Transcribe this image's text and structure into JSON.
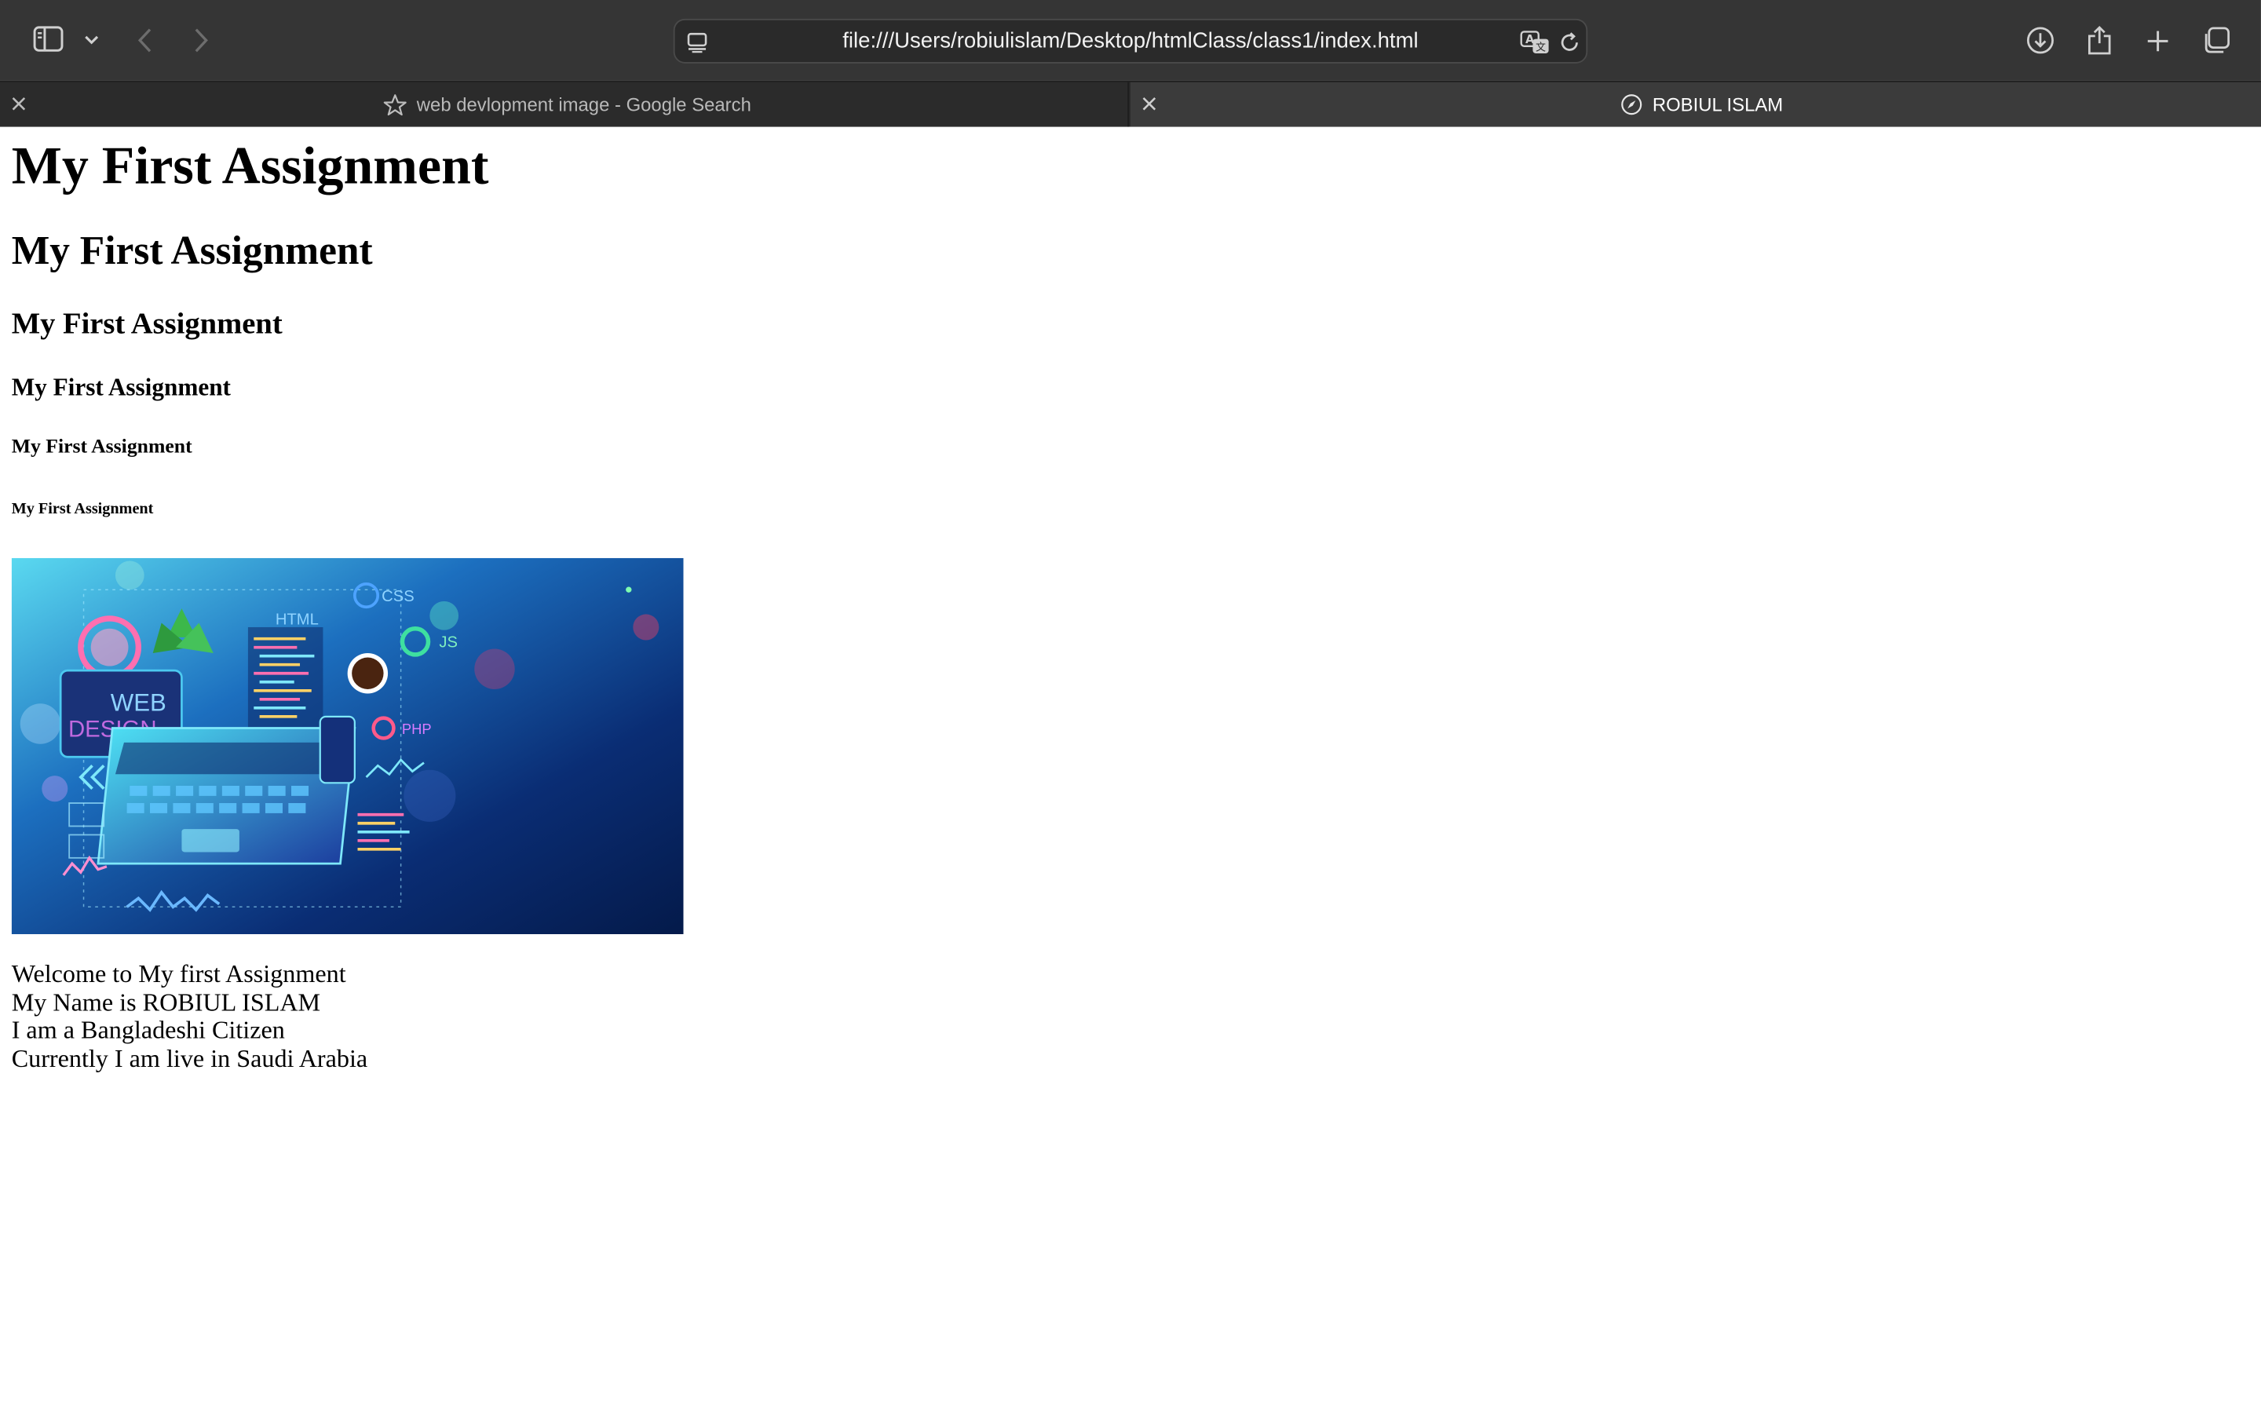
{
  "browser": {
    "address_bar": {
      "url": "file:///Users/robiulislam/Desktop/htmlClass/class1/index.html"
    },
    "tabs": [
      {
        "title": "web devlopment image - Google Search",
        "icon": "star-icon",
        "active": false
      },
      {
        "title": "ROBIUL ISLAM",
        "icon": "compass-icon",
        "active": true
      }
    ],
    "toolbar_icons": [
      "sidebar-icon",
      "chevron-down-icon",
      "back-icon",
      "forward-icon",
      "page-menu-icon",
      "translate-icon",
      "reload-icon",
      "download-icon",
      "share-icon",
      "new-tab-icon",
      "tab-overview-icon"
    ]
  },
  "page": {
    "headings": [
      "My First Assignment",
      "My First Assignment",
      "My First Assignment",
      "My First Assignment",
      "My First Assignment",
      "My First Assignment"
    ],
    "image": {
      "labels": [
        "WEB",
        "DESIGN",
        "HTML",
        "CSS",
        "JS",
        "PHP"
      ]
    },
    "lines": [
      "Welcome to My first Assignment",
      "My Name is ROBIUL ISLAM",
      "I am a Bangladeshi Citizen",
      "Currently I am live in Saudi Arabia"
    ]
  },
  "colors": {
    "toolbar_bg": "#353535",
    "tabbar_bg": "#2b2b2b",
    "active_tab_bg": "#3b3b3b",
    "page_bg": "#ffffff",
    "image_gradient_start": "#5ad9f0",
    "image_gradient_end": "#041a4a"
  }
}
